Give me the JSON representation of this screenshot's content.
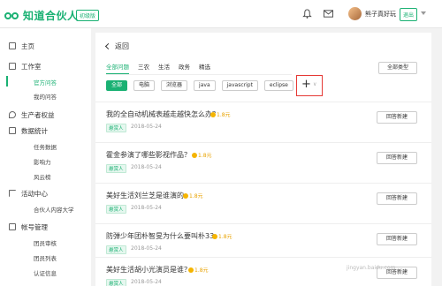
{
  "header": {
    "brand": "知道合伙人",
    "beta_label": "初级版",
    "username": "熊子真好玩",
    "logout_label": "退出"
  },
  "sidebar": {
    "home": "主页",
    "workspace": "工作室",
    "workspace_items": [
      "官方问答",
      "我的问答"
    ],
    "ecosystem": "生产者权益",
    "stats": "数据统计",
    "stats_items": [
      "任务数据",
      "影响力",
      "风云榜"
    ],
    "activity": "活动中心",
    "activity_items": [
      "合伙人内容大学"
    ],
    "account": "帐号管理",
    "account_items": [
      "团员审核",
      "团员列表",
      "认证信息"
    ]
  },
  "main": {
    "back_label": "返回",
    "tabs": [
      "全部问题",
      "三农",
      "生活",
      "政务",
      "精选"
    ],
    "all_types_label": "全部类型",
    "filters": [
      "全部",
      "电脑",
      "浏览器",
      "java",
      "javascript",
      "eclipse"
    ],
    "questions": [
      {
        "title": "我的全自动机械表越走越快怎么办？",
        "reward": "1.8元",
        "tag": "悬赏人",
        "date": "2018-05-24",
        "button": "回答新建"
      },
      {
        "title": "霍金参演了哪些影视作品？",
        "reward": "1.8元",
        "tag": "悬赏人",
        "date": "2018-05-24",
        "button": "回答新建"
      },
      {
        "title": "美好生活刘兰芝是谁演的",
        "reward": "1.8元",
        "tag": "悬赏人",
        "date": "2018-05-24",
        "button": "回答新建"
      },
      {
        "title": "防弹少年团朴智旻为什么要叫朴33",
        "reward": "1.8元",
        "tag": "悬赏人",
        "date": "2018-05-24",
        "button": "回答新建"
      },
      {
        "title": "美好生活胡小光演员是谁？",
        "reward": "1.8元",
        "tag": "悬赏人",
        "date": "2018-05-24",
        "button": "回答新建"
      }
    ]
  },
  "watermark": "jingyan.baidu.com"
}
